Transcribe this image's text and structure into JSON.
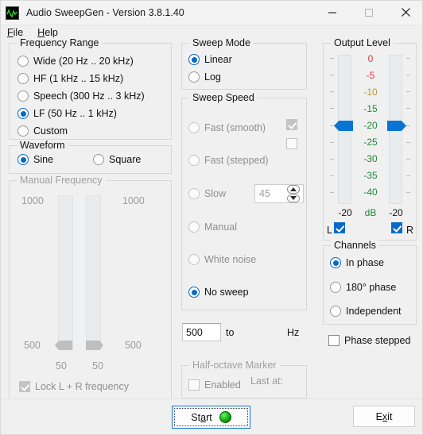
{
  "window": {
    "title": "Audio SweepGen - Version 3.8.1.40",
    "icon": "sine-wave-icon",
    "minimize_label": "–",
    "maximize_label": "□",
    "close_label": "✕"
  },
  "menu": {
    "items": [
      {
        "label": "File",
        "mnemonic": "F",
        "rest": "ile"
      },
      {
        "label": "Help",
        "mnemonic": "H",
        "rest": "elp"
      }
    ]
  },
  "frequency_range": {
    "legend": "Frequency Range",
    "options": [
      {
        "label": "Wide  (20 Hz .. 20 kHz)",
        "selected": false
      },
      {
        "label": "HF  (1 kHz .. 15 kHz)",
        "selected": false
      },
      {
        "label": "Speech  (300 Hz .. 3 kHz)",
        "selected": false
      },
      {
        "label": "LF  (50 Hz .. 1 kHz)",
        "selected": true
      },
      {
        "label": "Custom",
        "selected": false
      }
    ]
  },
  "waveform": {
    "legend": "Waveform",
    "options": [
      {
        "label": "Sine",
        "selected": true
      },
      {
        "label": "Square",
        "selected": false
      }
    ]
  },
  "manual_frequency": {
    "legend": "Manual Frequency",
    "enabled": false,
    "left_top_label": "1000",
    "left_bottom_label": "500",
    "right_top_label": "1000",
    "right_bottom_label": "500",
    "left_value": "50",
    "right_value": "50",
    "lock_label": "Lock L + R frequency",
    "lock_checked": true
  },
  "sweep_mode": {
    "legend": "Sweep Mode",
    "options": [
      {
        "label": "Linear",
        "selected": true
      },
      {
        "label": "Log",
        "selected": false
      }
    ]
  },
  "sweep_speed": {
    "legend": "Sweep Speed",
    "options": [
      {
        "label": "Fast (smooth)",
        "selected": false
      },
      {
        "label": "Fast (stepped)",
        "selected": false
      },
      {
        "label": "Slow",
        "selected": false
      },
      {
        "label": "Manual",
        "selected": false
      },
      {
        "label": "White noise",
        "selected": false
      },
      {
        "label": "No sweep",
        "selected": true
      }
    ],
    "aux_checkbox_top_checked": true,
    "aux_checkbox_bottom_checked": false,
    "slow_value": "45"
  },
  "frequency_row": {
    "start_value": "500",
    "to_label": "to",
    "end_value": "",
    "unit_label": "Hz"
  },
  "half_octave": {
    "legend": "Half-octave Marker",
    "enabled_label": "Enabled",
    "enabled_checked": false,
    "last_at_label": "Last at:"
  },
  "output_level": {
    "legend": "Output Level",
    "scale": [
      {
        "value": "0",
        "color": "#e03636"
      },
      {
        "value": "-5",
        "color": "#e03636"
      },
      {
        "value": "-10",
        "color": "#b09a33"
      },
      {
        "value": "-15",
        "color": "#1f8a3a"
      },
      {
        "value": "-20",
        "color": "#1f8a3a"
      },
      {
        "value": "-25",
        "color": "#1f8a3a"
      },
      {
        "value": "-30",
        "color": "#1f8a3a"
      },
      {
        "value": "-35",
        "color": "#1f8a3a"
      },
      {
        "value": "-40",
        "color": "#1f8a3a"
      }
    ],
    "left_value": "-20",
    "right_value": "-20",
    "unit_label": "dB",
    "unit_color": "#1f8a3a",
    "left_channel_label": "L",
    "right_channel_label": "R",
    "left_channel_checked": true,
    "right_channel_checked": true
  },
  "channels": {
    "legend": "Channels",
    "options": [
      {
        "label": "In phase",
        "selected": true
      },
      {
        "label": "180° phase",
        "selected": false
      },
      {
        "label": "Independent",
        "selected": false
      }
    ],
    "phase_stepped_label": "Phase stepped",
    "phase_stepped_checked": false
  },
  "footer": {
    "start_mnemonic_before": "St",
    "start_mnemonic": "a",
    "start_mnemonic_after": "rt",
    "start_label": "Start",
    "led": "green-led-indicator",
    "exit_mnemonic_before": "E",
    "exit_mnemonic": "x",
    "exit_mnemonic_after": "it",
    "exit_label": "Exit"
  }
}
